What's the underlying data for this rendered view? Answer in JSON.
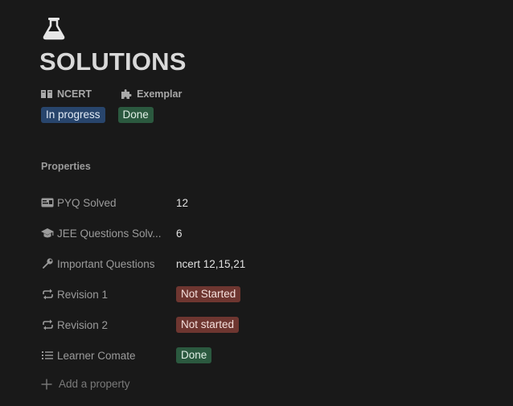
{
  "page": {
    "icon": "flask-icon",
    "title": "SOLUTIONS"
  },
  "relations": [
    {
      "icon": "book-icon",
      "label": "NCERT"
    },
    {
      "icon": "puzzle-icon",
      "label": "Exemplar"
    }
  ],
  "relation_status": [
    {
      "label": "In progress",
      "color": "#28456c"
    },
    {
      "label": "Done",
      "color": "#2b593f"
    }
  ],
  "properties_heading": "Properties",
  "properties": [
    {
      "icon": "id-card-icon",
      "name": "PYQ Solved",
      "value": "12",
      "type": "text"
    },
    {
      "icon": "graduation-cap-icon",
      "name": "JEE Questions Solv...",
      "value": "6",
      "type": "text"
    },
    {
      "icon": "wrench-icon",
      "name": "Important Questions",
      "value": "ncert 12,15,21",
      "type": "text"
    },
    {
      "icon": "repeat-icon",
      "name": "Revision 1",
      "value": "Not Started",
      "type": "status",
      "color": "#6e3630"
    },
    {
      "icon": "repeat-icon",
      "name": "Revision 2",
      "value": "Not started",
      "type": "status",
      "color": "#6e3630"
    },
    {
      "icon": "list-icon",
      "name": "Learner Comate",
      "value": "Done",
      "type": "status",
      "color": "#2b593f"
    }
  ],
  "add_property_label": "Add a property"
}
